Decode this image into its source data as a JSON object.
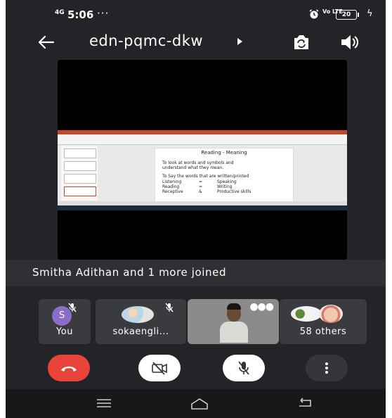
{
  "status_bar": {
    "network_label": "4G",
    "time": "5:06",
    "more_dots": "···",
    "volte_label": "Vo LTE",
    "battery": "20"
  },
  "header": {
    "meeting_code": "edn-pqmc-dkw"
  },
  "shared_screen": {
    "slide_title": "Reading - Meaning",
    "line1": "To look at words and symbols and",
    "line2": "understand what they mean.",
    "line3": "To Say the words that are written/printed",
    "rows": [
      {
        "left": "Listening",
        "sym": "=",
        "right": "Speaking"
      },
      {
        "left": "Reading",
        "sym": "=",
        "right": "Writing"
      },
      {
        "left": "Receptive",
        "sym": "&",
        "right": "Productive skills"
      }
    ]
  },
  "banner": {
    "text": "Smitha Adithan and 1 more joined"
  },
  "participants": [
    {
      "avatar_letter": "S",
      "label": "You"
    },
    {
      "label": "sokaengli..."
    },
    {
      "label": ""
    },
    {
      "label": "58 others"
    }
  ],
  "colors": {
    "background": "#232427",
    "end_call": "#e8443a",
    "avatar": "#8a6cc9"
  }
}
